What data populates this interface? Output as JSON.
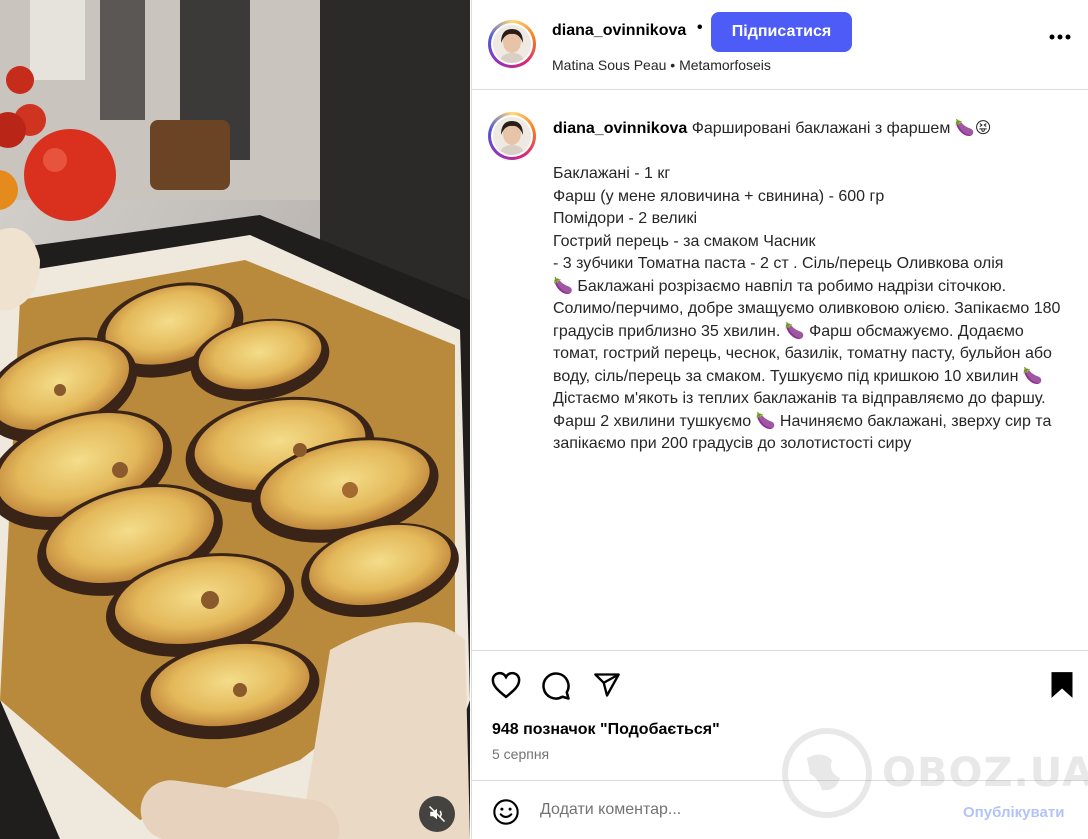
{
  "post": {
    "username": "diana_ovinnikova",
    "separator": "•",
    "follow_label": "Підписатися",
    "audio": "Matina Sous Peau • Metamorfoseis",
    "caption_title": "Фаршировані баклажані з фаршем 🍆😝",
    "caption_body": "\nБаклажані - 1 кг\nФарш (у мене яловичина + свинина) - 600 гр\nПомідори - 2 великі\nГострий перець - за смаком Часник\n- 3 зубчики Томатна паста - 2 ст . Сіль/перець Оливкова олія\n🍆 Баклажані розрізаємо навпіл та робимо надрізи сіточкою. Солимо/перчимо, добре змащуємо оливковою олією. Запікаємо 180 градусів приблизно 35 хвилин. 🍆 Фарш обсмажуємо. Додаємо томат, гострий перець, чеснок, базилік, томатну пасту, бульйон або воду, сіль/перець за смаком. Тушкуємо під кришкою 10 хвилин 🍆 Дістаємо м'якоть із теплих баклажанів та відправляємо до фаршу. Фарш 2 хвилини тушкуємо 🍆 Начиняємо баклажані, зверху сир та запікаємо при 200 градусів до золотистості сиру",
    "likes": "948 позначок \"Подобається\"",
    "date": "5 серпня"
  },
  "comment": {
    "placeholder": "Додати коментар...",
    "publish_label": "Опублікувати"
  },
  "watermark": "OBOZ.UA",
  "colors": {
    "accent": "#4d5cf6",
    "publish_disabled": "#b2c4f7",
    "secondary_text": "#737373",
    "divider": "#dbdbdb"
  },
  "icons": {
    "like": "heart-icon",
    "comment": "comment-icon",
    "share": "share-icon",
    "save": "bookmark-icon",
    "more": "more-icon",
    "emoji": "emoji-icon",
    "mute": "mute-icon"
  }
}
